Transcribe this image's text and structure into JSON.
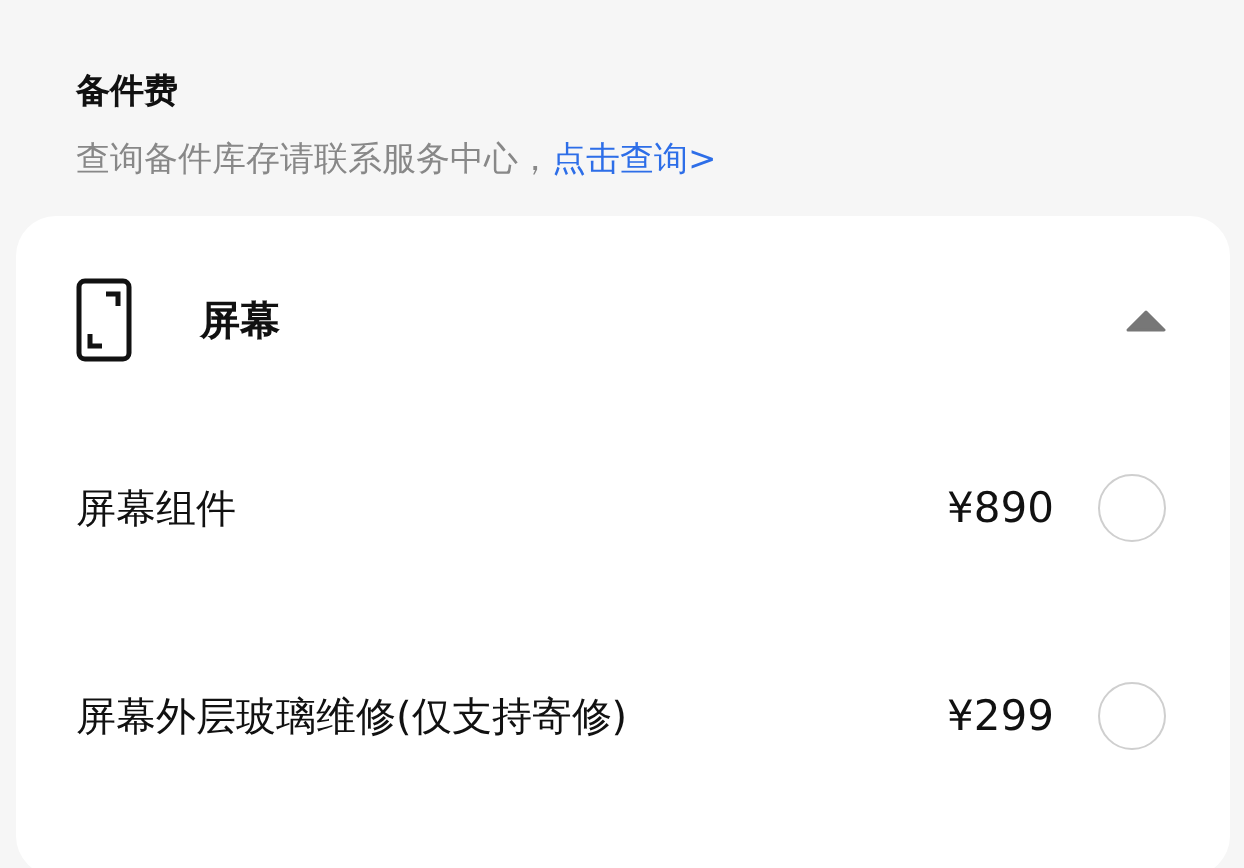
{
  "section": {
    "title": "备件费",
    "note": "查询备件库存请联系服务中心，",
    "link": "点击查询>"
  },
  "category": {
    "label": "屏幕",
    "expanded": true,
    "items": [
      {
        "name": "屏幕组件",
        "price": "¥890",
        "selected": false
      },
      {
        "name": "屏幕外层玻璃维修(仅支持寄修)",
        "price": "¥299",
        "selected": false
      }
    ]
  }
}
